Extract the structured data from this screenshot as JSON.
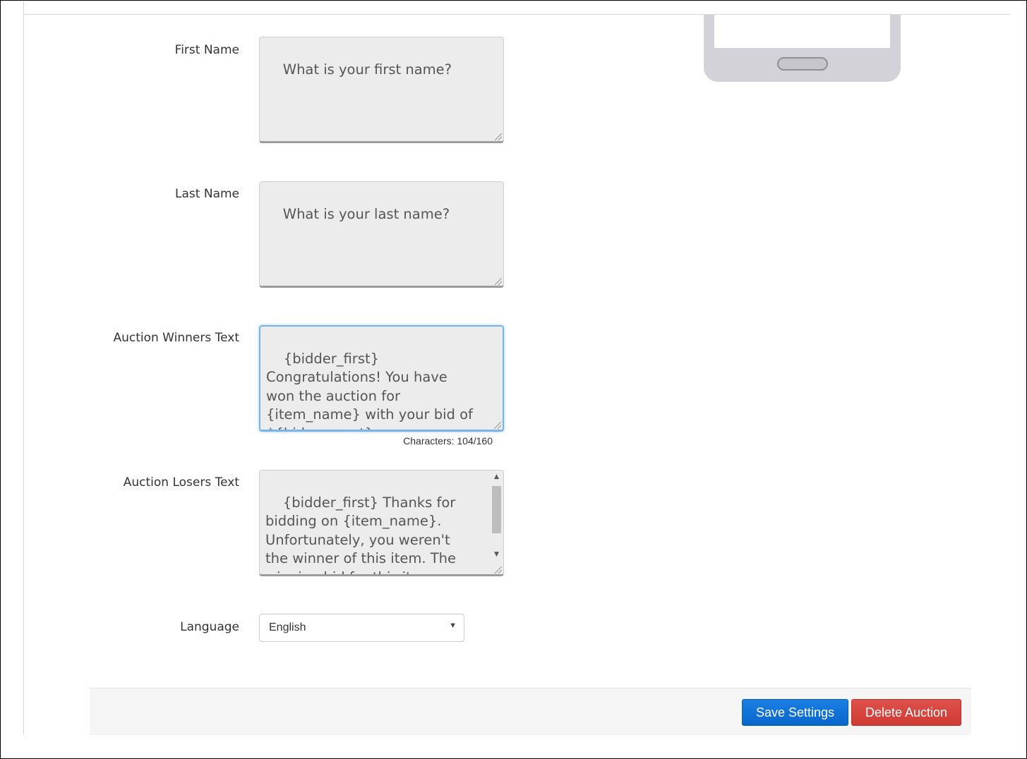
{
  "form": {
    "first_name": {
      "label": "First Name",
      "value": "What is your first name?"
    },
    "last_name": {
      "label": "Last Name",
      "value": "What is your last name?"
    },
    "winners_text": {
      "label": "Auction Winners Text",
      "value": "{bidder_first}\nCongratulations! You have\nwon the auction for\n{item_name} with your bid of\n${bid_amount}.",
      "char_count": "Characters: 104/160"
    },
    "losers_text": {
      "label": "Auction Losers Text",
      "value": "{bidder_first} Thanks for\nbidding on {item_name}.\nUnfortunately, you weren't\nthe winner of this item. The\nwinning bid for this item was\n${bid_amount}."
    },
    "language": {
      "label": "Language",
      "selected": "English"
    }
  },
  "actions": {
    "save_label": "Save Settings",
    "delete_label": "Delete Auction"
  },
  "colors": {
    "save": "#0b6ed6",
    "delete": "#d9413b"
  }
}
